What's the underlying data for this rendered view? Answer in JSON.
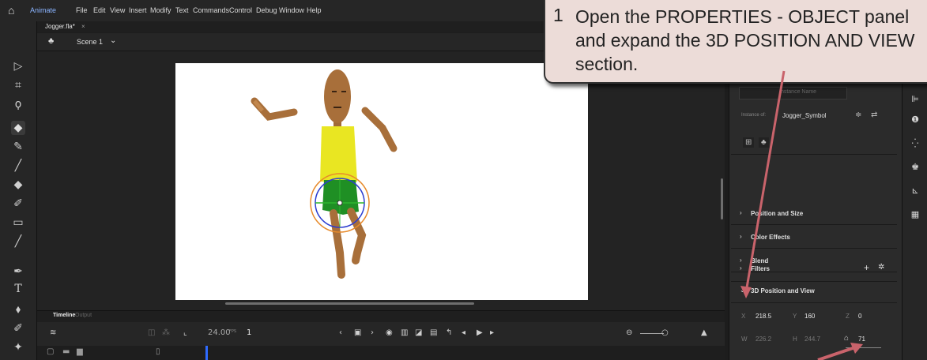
{
  "menubar": {
    "app_name": "Animate",
    "items": [
      "File",
      "Edit",
      "View",
      "Insert",
      "Modify",
      "Text",
      "Commands",
      "Control",
      "Debug",
      "Window",
      "Help"
    ]
  },
  "document": {
    "tab_label": "Jogger.fla*",
    "tab_close": "×",
    "scene_label": "Scene 1"
  },
  "timeline": {
    "tab_timeline": "Timeline",
    "tab_output": "Output",
    "fps": "24.00",
    "fps_unit": "FPS",
    "frame": "1"
  },
  "properties": {
    "instance_name_placeholder": "Instance Name",
    "instance_of_label": "Instance of:",
    "instance_of_value": "Jogger_Symbol",
    "sections": [
      {
        "label": "Position and Size",
        "chevron": "›"
      },
      {
        "label": "Color Effects",
        "chevron": "›"
      },
      {
        "label": "Blend",
        "chevron": "›"
      },
      {
        "label": "Filters",
        "chevron": "›"
      },
      {
        "label": "3D Position and View",
        "chevron": "⌄"
      }
    ],
    "filters_add": "+",
    "x_label": "X",
    "x_value": "218.5",
    "y_label": "Y",
    "y_value": "160",
    "z_label": "Z",
    "z_value": "0",
    "w_label": "W",
    "w_value": "226.2",
    "h_label": "H",
    "h_value": "244.7",
    "perspective_value": "71"
  },
  "callout": {
    "number": "1",
    "text": "Open the PROPERTIES - OBJECT panel and expand the 3D POSITION AND VIEW section."
  },
  "colors": {
    "callout_bg": "#ecdcd8",
    "arrow": "#c9636b",
    "torso": "#e9e622",
    "shorts": "#1f8f24",
    "wood": "#b27a42"
  }
}
